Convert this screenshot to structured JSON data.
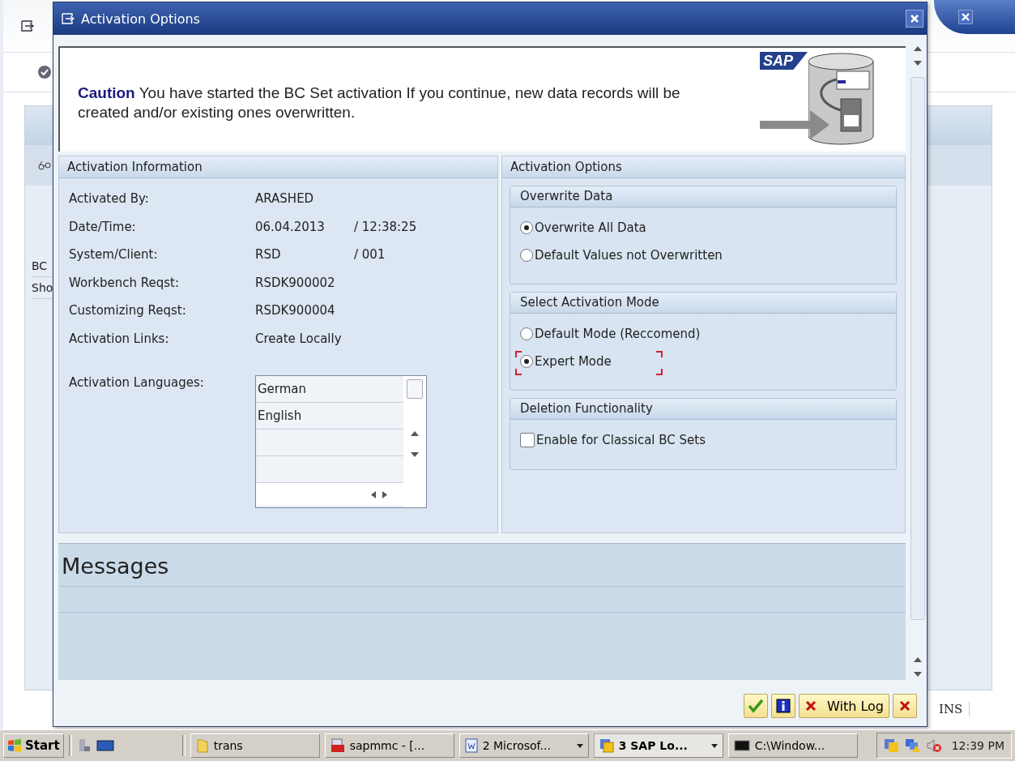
{
  "background_window": {
    "rows": [
      "BC",
      "Sho"
    ],
    "status_mode": "INS"
  },
  "dialog": {
    "title": "Activation Options",
    "logo": "SAP",
    "caution": {
      "label": "Caution",
      "text": "You have started the BC Set activation If you continue, new data records will be created and/or existing ones overwritten."
    },
    "info_panel": {
      "title": "Activation Information",
      "fields": [
        {
          "label": "Activated By:",
          "value": "ARASHED"
        },
        {
          "label": "Date/Time:",
          "value": "06.04.2013",
          "suffix": "/ 12:38:25"
        },
        {
          "label": "System/Client:",
          "value": "RSD",
          "suffix": "/ 001"
        },
        {
          "label": "Workbench Reqst:",
          "value": "RSDK900002"
        },
        {
          "label": "Customizing Reqst:",
          "value": "RSDK900004"
        },
        {
          "label": "Activation Links:",
          "value": "Create Locally"
        }
      ],
      "languages": {
        "label": "Activation Languages:",
        "items": [
          "German",
          "English"
        ]
      }
    },
    "options_panel": {
      "title": "Activation Options",
      "groups": [
        {
          "title": "Overwrite Data",
          "options": [
            {
              "kind": "radio",
              "label": "Overwrite All Data",
              "selected": true,
              "focused": false
            },
            {
              "kind": "radio",
              "label": "Default Values not Overwritten",
              "selected": false,
              "focused": false
            }
          ]
        },
        {
          "title": "Select Activation Mode",
          "options": [
            {
              "kind": "radio",
              "label": "Default Mode (Reccomend)",
              "selected": false,
              "focused": false
            },
            {
              "kind": "radio",
              "label": "Expert Mode",
              "selected": true,
              "focused": true
            }
          ]
        },
        {
          "title": "Deletion Functionality",
          "options": [
            {
              "kind": "checkbox",
              "label": "Enable for Classical BC Sets",
              "selected": false,
              "focused": false
            }
          ]
        }
      ]
    },
    "messages": {
      "title": "Messages"
    },
    "buttons": [
      {
        "kind": "confirm"
      },
      {
        "kind": "info"
      },
      {
        "kind": "log",
        "label": "With Log"
      },
      {
        "kind": "cancel"
      }
    ]
  },
  "taskbar": {
    "start": "Start",
    "tasks": [
      {
        "kind": "folder",
        "label": "trans",
        "selected": false,
        "dropdown": false
      },
      {
        "kind": "toolbox",
        "label": "sapmmc - [...",
        "selected": false,
        "dropdown": false
      },
      {
        "kind": "word",
        "label": "2 Microsof...",
        "selected": false,
        "dropdown": true
      },
      {
        "kind": "sap",
        "label": "3 SAP Lo...",
        "selected": true,
        "dropdown": true
      },
      {
        "kind": "console",
        "label": "C:\\Window...",
        "selected": false,
        "dropdown": false
      }
    ],
    "clock": "12:39 PM"
  }
}
